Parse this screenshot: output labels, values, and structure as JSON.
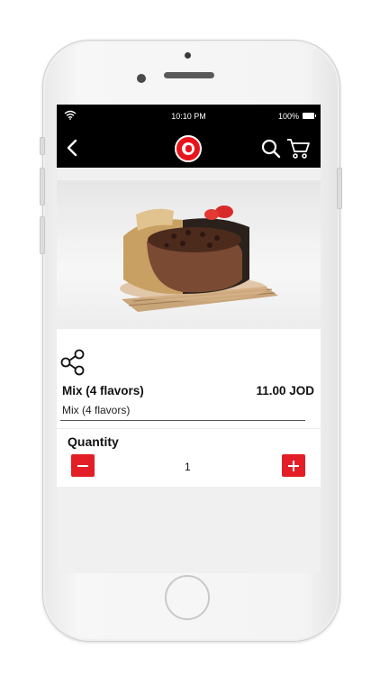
{
  "status_bar": {
    "time": "10:10 PM",
    "battery": "100%",
    "wifi_icon": "wifi-icon",
    "battery_icon": "battery-icon"
  },
  "nav": {
    "back_icon": "chevron-left-icon",
    "logo_icon": "brand-logo",
    "search_icon": "search-icon",
    "cart_icon": "cart-icon"
  },
  "product": {
    "name": "Mix (4 flavors)",
    "price": "11.00 JOD",
    "subtitle": "Mix (4 flavors)",
    "share_icon": "share-icon"
  },
  "quantity": {
    "label": "Quantity",
    "value": "1",
    "minus_icon": "minus-icon",
    "plus_icon": "plus-icon"
  },
  "colors": {
    "accent": "#e31e26",
    "bar": "#000000",
    "screen_bg": "#f0f0f0"
  }
}
